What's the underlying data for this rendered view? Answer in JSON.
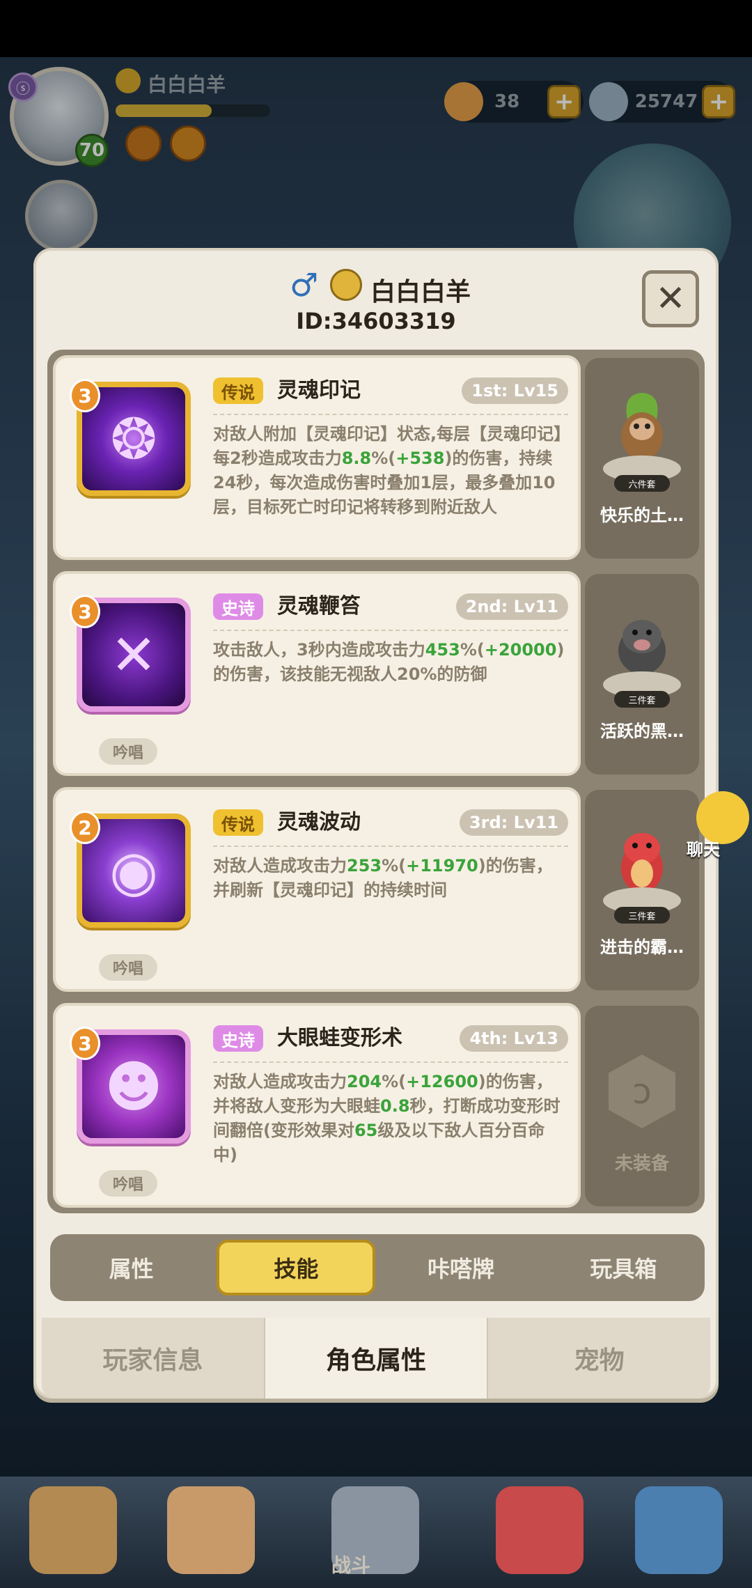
{
  "hud": {
    "player_name": "白白白羊",
    "level": "70",
    "resource_1": "38",
    "resource_2": "25747"
  },
  "dialog": {
    "player_name": "白白白羊",
    "gender_symbol": "♂",
    "player_id": "ID:34603319",
    "close_symbol": "✕"
  },
  "skills": [
    {
      "level": "3",
      "rarity": "传说",
      "name": "灵魂印记",
      "slot": "1st: Lv15",
      "desc_parts": [
        "对敌人附加【灵魂印记】状态,每层【灵魂印记】每2秒造成攻击力",
        "8.8",
        "%(",
        "+538",
        ")的伤害，持续24秒，每次造成伤害时叠加1层，最多叠加10层，目标死亡时印记将转移到附近敌人"
      ],
      "chant": ""
    },
    {
      "level": "3",
      "rarity": "史诗",
      "name": "灵魂鞭笞",
      "slot": "2nd: Lv11",
      "desc_parts": [
        "攻击敌人，3秒内造成攻击力",
        "453",
        "%(",
        "+20000",
        ")的伤害，该技能无视敌人20%的防御"
      ],
      "chant": "吟唱"
    },
    {
      "level": "2",
      "rarity": "传说",
      "name": "灵魂波动",
      "slot": "3rd: Lv11",
      "desc_parts": [
        "对敌人造成攻击力",
        "253",
        "%(",
        "+11970",
        ")的伤害，并刷新【灵魂印记】的持续时间"
      ],
      "chant": "吟唱"
    },
    {
      "level": "3",
      "rarity": "史诗",
      "name": "大眼蛙变形术",
      "slot": "4th: Lv13",
      "desc_parts": [
        "对敌人造成攻击力",
        "204",
        "%(",
        "+12600",
        ")的伤害，并将敌人变形为大眼蛙",
        "0.8",
        "秒，打断成功变形时间翻倍(变形效果对",
        "65",
        "级及以下敌人百分百命中)"
      ],
      "chant": "吟唱"
    }
  ],
  "pets": [
    {
      "set": "六件套",
      "name": "快乐的土…"
    },
    {
      "set": "三件套",
      "name": "活跃的黑…"
    },
    {
      "set": "三件套",
      "name": "进击的霸…"
    },
    {
      "set": "",
      "name": "未装备"
    }
  ],
  "subtabs": [
    "属性",
    "技能",
    "咔嗒牌",
    "玩具箱"
  ],
  "bottom_tabs": [
    "玩家信息",
    "角色属性",
    "宠物"
  ],
  "chat_label": "聊天",
  "nav_label": "战斗",
  "colors": {
    "legend": "#efc02f",
    "epic": "#de8be6",
    "highlight": "#3aa33a",
    "active_tab": "#f3d45b"
  }
}
